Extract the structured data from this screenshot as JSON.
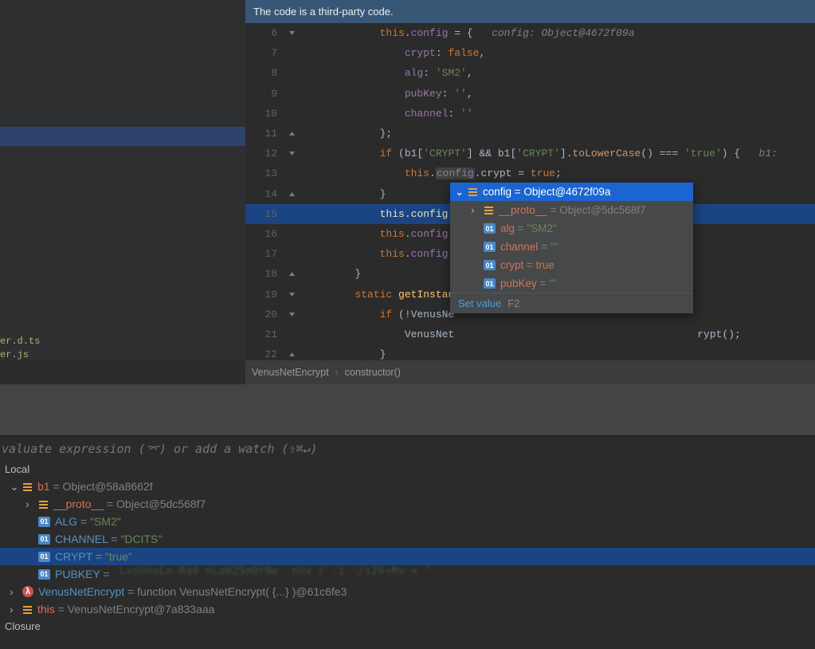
{
  "banner": {
    "text": "The code is a third-party code."
  },
  "left_files": [
    "er.d.ts",
    "er.js"
  ],
  "gutter": [
    {
      "n": "6",
      "fold": "open"
    },
    {
      "n": "7",
      "fold": ""
    },
    {
      "n": "8",
      "fold": ""
    },
    {
      "n": "9",
      "fold": ""
    },
    {
      "n": "10",
      "fold": ""
    },
    {
      "n": "11",
      "fold": "close"
    },
    {
      "n": "12",
      "fold": "open"
    },
    {
      "n": "13",
      "fold": ""
    },
    {
      "n": "14",
      "fold": "close"
    },
    {
      "n": "15",
      "fold": ""
    },
    {
      "n": "16",
      "fold": ""
    },
    {
      "n": "17",
      "fold": ""
    },
    {
      "n": "18",
      "fold": "close"
    },
    {
      "n": "19",
      "fold": "open"
    },
    {
      "n": "20",
      "fold": "open"
    },
    {
      "n": "21",
      "fold": ""
    },
    {
      "n": "22",
      "fold": "close"
    }
  ],
  "code": {
    "l6": {
      "indent": "            ",
      "a": "this",
      "b": ".",
      "c": "config",
      "d": " = {   ",
      "comment": "config: Object@4672f09a"
    },
    "l7": {
      "indent": "                ",
      "prop": "crypt",
      "sep": ": ",
      "val": "false",
      "tail": ","
    },
    "l8": {
      "indent": "                ",
      "prop": "alg",
      "sep": ": ",
      "val": "'SM2'",
      "tail": ","
    },
    "l9": {
      "indent": "                ",
      "prop": "pubKey",
      "sep": ": ",
      "val": "''",
      "tail": ","
    },
    "l10": {
      "indent": "                ",
      "prop": "channel",
      "sep": ": ",
      "val": "''",
      "tail": ""
    },
    "l11": {
      "indent": "            ",
      "txt": "};"
    },
    "l12": {
      "indent": "            ",
      "a": "if",
      "b": " (b1[",
      "c": "'CRYPT'",
      "d": "] && b1[",
      "e": "'CRYPT'",
      "f": "].",
      "g": "toLowerCase",
      "h": "() === ",
      "i": "'true'",
      "j": ") {",
      "comment": "   b1:"
    },
    "l13": {
      "indent": "                ",
      "a": "this",
      "b": ".",
      "c": "config",
      "d": ".crypt = ",
      "e": "true",
      "f": ";"
    },
    "l14": {
      "indent": "            ",
      "txt": "}"
    },
    "l15": {
      "indent": "            ",
      "a": "this",
      "b": ".",
      "c": "config",
      "d": "."
    },
    "l16": {
      "indent": "            ",
      "a": "this",
      "b": ".",
      "c": "config",
      "d": "."
    },
    "l17": {
      "indent": "            ",
      "a": "this",
      "b": ".",
      "c": "config",
      "d": "."
    },
    "l18": {
      "indent": "        ",
      "txt": "}"
    },
    "l19": {
      "indent": "        ",
      "a": "static",
      "b": " ",
      "c": "getInstan"
    },
    "l20": {
      "indent": "            ",
      "a": "if",
      "b": " (!VenusNe"
    },
    "l21": {
      "indent": "                ",
      "a": "VenusNet",
      "tail": "rypt();"
    },
    "l22": {
      "indent": "            ",
      "txt": "}"
    }
  },
  "popup": {
    "root": {
      "name": "config",
      "sep": " = ",
      "val": "Object@4672f09a"
    },
    "proto": {
      "name": "__proto__",
      "sep": " = ",
      "val": "Object@5dc568f7"
    },
    "items": [
      {
        "name": "alg",
        "sep": " = ",
        "val": "\"SM2\"",
        "type": "string"
      },
      {
        "name": "channel",
        "sep": " = ",
        "val": "\"\"",
        "type": "string"
      },
      {
        "name": "crypt",
        "sep": " = ",
        "val": "true",
        "type": "bool"
      },
      {
        "name": "pubKey",
        "sep": " = ",
        "val": "\"\"",
        "type": "string"
      }
    ],
    "set_value": "Set value",
    "kb": "F2"
  },
  "breadcrumb": {
    "a": "VenusNetEncrypt",
    "b": "constructor()"
  },
  "watch_placeholder": "valuate expression (⌤) or add a watch (⇧⌘↵)",
  "overlay": "macos",
  "vars": {
    "header": "Local",
    "b1": {
      "name": "b1",
      "sep": " = ",
      "val": "Object@58a8662f"
    },
    "proto": {
      "name": "__proto__",
      "sep": " = ",
      "val": "Object@5dc568f7"
    },
    "items": [
      {
        "name": "ALG",
        "sep": " = ",
        "val": "\"SM2\""
      },
      {
        "name": "CHANNEL",
        "sep": " = ",
        "val": "\"DCITS\""
      },
      {
        "name": "CRYPT",
        "sep": " = ",
        "val": "\"true\""
      },
      {
        "name": "PUBKEY",
        "sep": " = ",
        "val": ""
      }
    ],
    "venus": {
      "name": "VenusNetEncrypt",
      "sep": " = ",
      "val": "function VenusNetEncrypt( {...} )@61c6fe3"
    },
    "this": {
      "name": "this",
      "sep": " = ",
      "val": "VenusNetEncrypt@7a833aaa"
    },
    "closure": "Closure"
  },
  "blur": "LvnUnuLo   Ra0  nLaW2SmQrNe   .nUv      /  .i             '/i26+Mv         = \""
}
